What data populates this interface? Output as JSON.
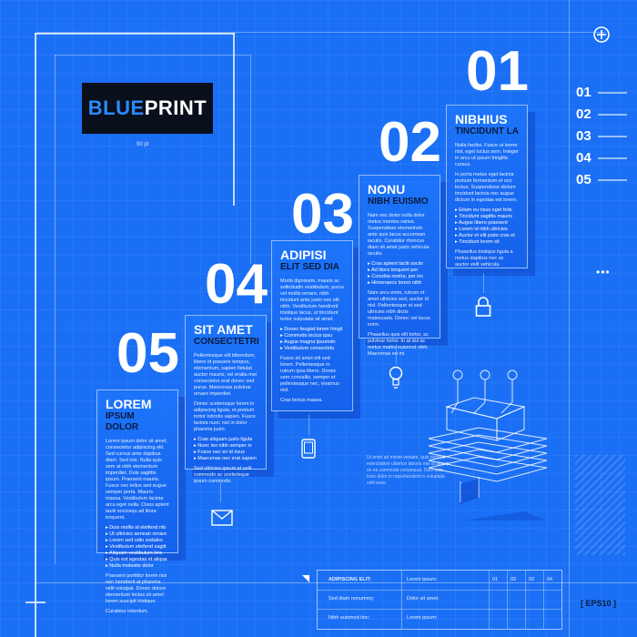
{
  "logo": {
    "blue": "BLUE",
    "white": "PRINT",
    "dimension": "90 pt"
  },
  "steps": [
    {
      "number": "01",
      "title": "NIBHIUS",
      "subtitle": "TINCIDUNT LA",
      "para1": "Nulla facilisi. Fusce ut lorem nisl, eget luctus sem. Integer in arcu ut ipsum fringilla cursus.",
      "para2": "In porta metus eget lacinia pretium fermentum et orci lectus. Suspendisse dictum tincidunt lacinia nec augue dictum in egestas est lorem.",
      "bullets": [
        "Etiam eu risus eget felis",
        "Tincidunt sagittis mauris",
        "Augue libero praesent",
        "Lorem id nibh ultricies",
        "Auctor et elit justo cras et",
        "Tincidunt lorem sit"
      ],
      "para3": "Phasellus tristique ligula a metus dapibus nec ac auctor velit vehicula."
    },
    {
      "number": "02",
      "title": "NONU",
      "subtitle": "NIBH EUISMO",
      "para1": "Nam nec dolor nulla dolor metus montes varius. Suspendisse elementum ante quis lacus accumsan iaculis. Curabitur rhoncus diam sit amet justo vehicula iaculis.",
      "bullets": [
        "Cras aptent taciti sociis",
        "Ad litora torquent per",
        "Conubia nostra, per inc",
        "Himenaeos lorem nibh"
      ],
      "para2": "Nam arcu enim, rutrum et amet ultricies sed, auctor id nisl. Pellentesque et sed ultricies nibh dictis malesuada. Donec vel lacus enim.",
      "para3": "Phasellus quis elit tortor, ac pulvinar tortor. In at dui ac metus mattis euismod nibh. Maecenas eu mi."
    },
    {
      "number": "03",
      "title": "ADIPISI",
      "subtitle": "ELIT SED DIA",
      "para1": "Morbi dignissim, mauris ac sollicitudin vestibulum, purus vel mollis ornare, nibh tincidunt ante justo nec elit nibh. Vestibulum hendrerit tristique lacus, ut tincidunt tortor vulputate sit amet.",
      "bullets": [
        "Donec feugiat lorem fringil",
        "Commodo lectus ipsu",
        "Augue magna ipsumdo",
        "Vestibulum consectetu"
      ],
      "para2": "Fusce sit amet elit sed lorem. Pellentesque in rutrum ipsa libero. Donec sem convallis, semper et pellentesque nec, vivamus nisl.",
      "para3": "Cras lectus massa."
    },
    {
      "number": "04",
      "title": "SIT AMET",
      "subtitle": "CONSECTETRI",
      "para1": "Pellentesque elit bibendum, libero id posuere tempus, elementum, sapien fistulat auctor mauris, vel eratia mei consectetur erat donec sed purus. Maecenas pulvinar ornare imperdiet.",
      "para2": "Donec scelerisque lorem in adipiscing ligula, et pretium tortor lobortis sapien. Fusce lacinia nunc nisl in dolor pharetra justo.",
      "bullets": [
        "Cras aliquam justo ligula",
        "Nunc leo nibh semper in",
        "Fusce nec ex id risus",
        "Maecenas nec erat sapien"
      ],
      "para3": "Sed ultricies ipsum et velit commodo ac scelerisque ipsum commodo."
    },
    {
      "number": "05",
      "title": "LOREM",
      "subtitle": "IPSUM DOLOR",
      "para1": "Lorem ipsum dolor sit amet, consectetur adipiscing elit. Sed cursus ante dapibus diam. Sed nisi. Nulla quis sem at nibh elementum imperdiet. Duis sagittis ipsum. Praesent mauris. Fusce nec tellus sed augue semper porta. Mauris massa. Vestibulum lacinia arcu eget nulla. Class aptent taciti sociosqu ad litora torquent.",
      "bullets": [
        "Duis mollis id eleifend nib",
        "Ut ultricies aenean ornare",
        "Lorem sed odio sodales",
        "Vestibulum eleifend sagitt",
        "Aliquam vestibulum lore",
        "Quis est egestas et aliqua",
        "Nulla molestie dolor"
      ],
      "para2": "Praesent porttitor lorem nisi non hendrerit at pharetra velit volutpat. Donec dolore elementum lectus sit amet lorem suscipit tristique.",
      "para3": "Curabitur interdum."
    }
  ],
  "index": [
    "01",
    "02",
    "03",
    "04",
    "05"
  ],
  "annotation": "Ut enim ad minim veniam, quis nostrud exercitation ullamco laboris nisi ut aliquip ex ea commodo consequat. Duis aute irure dolor in reprehenderit in voluptate velit esse.",
  "table": {
    "rows": [
      {
        "label": "ADIPISCING ELIT:",
        "value": "Lorem ipsum:"
      },
      {
        "label": "Sed diam nonummy:",
        "value": "Dolor sit amet:"
      },
      {
        "label": "Nibh euismod tinc:",
        "value": "Lorem ipsum:"
      }
    ],
    "cols": [
      "01",
      "02",
      "03",
      "04"
    ]
  },
  "eps": "[ EPS10 ]"
}
